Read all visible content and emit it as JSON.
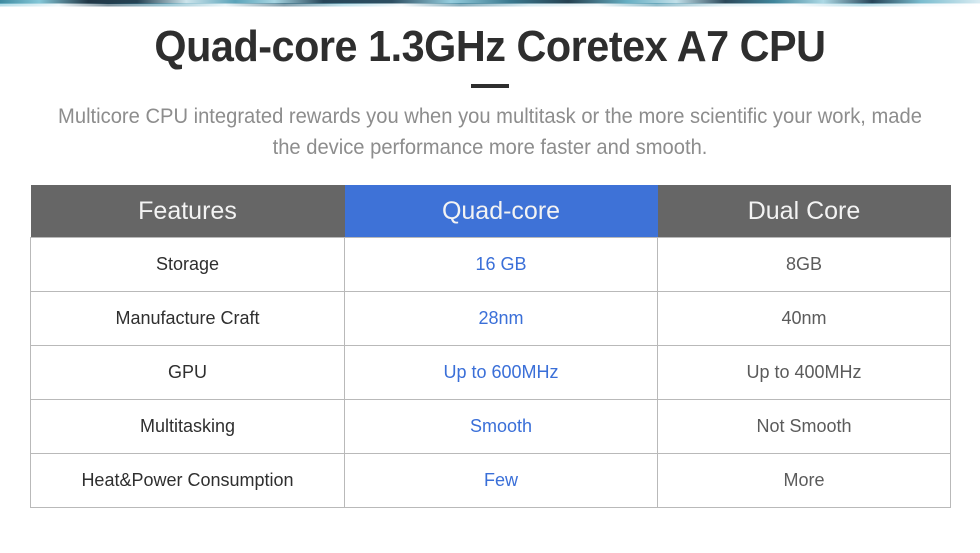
{
  "header": {
    "title": "Quad-core 1.3GHz Coretex A7 CPU",
    "subtitle": "Multicore CPU integrated rewards you when you multitask or the more scientific your work, made the device performance more faster and smooth."
  },
  "colors": {
    "header_gray": "#666666",
    "header_accent_blue": "#3e72d7",
    "cell_accent_blue": "#3a6fd8",
    "title_dark": "#2e2e2e",
    "subtitle_gray": "#8d8d8d",
    "border_gray": "#b9b9b9",
    "top_strip_teal": "#2d7f97"
  },
  "table": {
    "columns": [
      {
        "label": "Features",
        "highlighted": false
      },
      {
        "label": "Quad-core",
        "highlighted": true
      },
      {
        "label": "Dual Core",
        "highlighted": false
      }
    ],
    "rows": [
      {
        "feature": "Storage",
        "quad": "16 GB",
        "dual": "8GB"
      },
      {
        "feature": "Manufacture Craft",
        "quad": "28nm",
        "dual": "40nm"
      },
      {
        "feature": "GPU",
        "quad": "Up to 600MHz",
        "dual": "Up to 400MHz"
      },
      {
        "feature": "Multitasking",
        "quad": "Smooth",
        "dual": "Not Smooth"
      },
      {
        "feature": "Heat&Power Consumption",
        "quad": "Few",
        "dual": "More"
      }
    ]
  }
}
